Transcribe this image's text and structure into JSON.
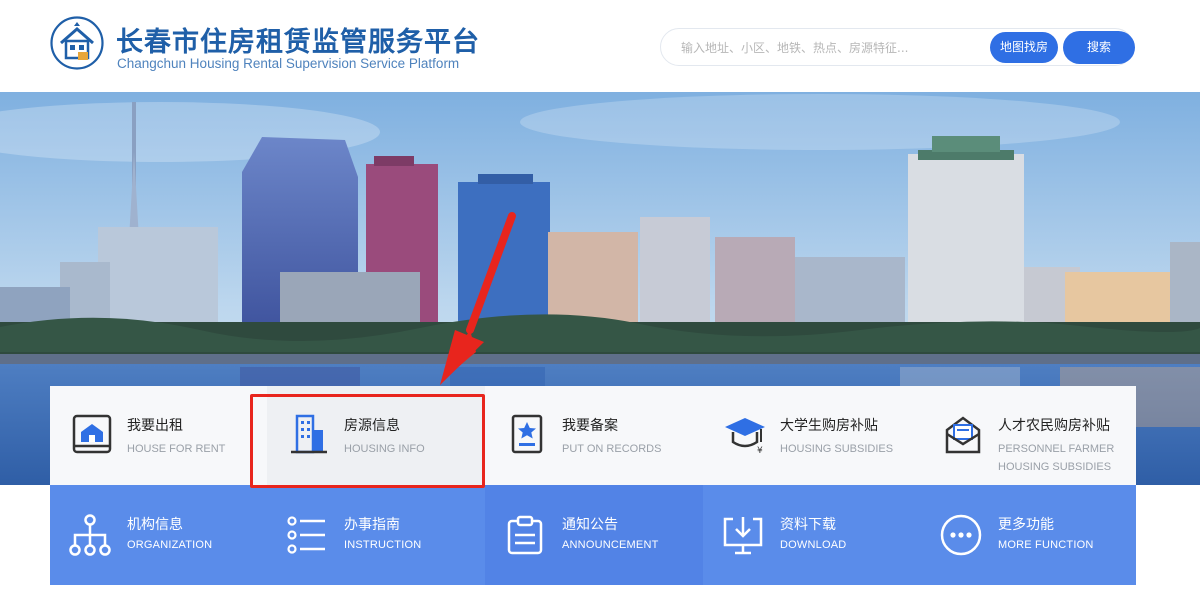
{
  "header": {
    "title": "长春市住房租赁监管服务平台",
    "subtitle": "Changchun Housing Rental Supervision Service Platform",
    "search_placeholder": "输入地址、小区、地铁、热点、房源特征...",
    "map_button": "地图找房",
    "search_button": "搜索"
  },
  "services_top": [
    {
      "cn": "我要出租",
      "en": "HOUSE FOR RENT",
      "icon": "house-rent-icon"
    },
    {
      "cn": "房源信息",
      "en": "HOUSING INFO",
      "icon": "building-icon"
    },
    {
      "cn": "我要备案",
      "en": "PUT ON RECORDS",
      "icon": "record-star-icon"
    },
    {
      "cn": "大学生购房补贴",
      "en": "HOUSING SUBSIDIES",
      "icon": "graduation-cap-icon"
    },
    {
      "cn": "人才农民购房补贴",
      "en": "PERSONNEL FARMER",
      "en2": "HOUSING SUBSIDIES",
      "icon": "mail-icon"
    }
  ],
  "services_bottom": [
    {
      "cn": "机构信息",
      "en": "ORGANIZATION",
      "icon": "org-chart-icon"
    },
    {
      "cn": "办事指南",
      "en": "INSTRUCTION",
      "icon": "list-icon"
    },
    {
      "cn": "通知公告",
      "en": "ANNOUNCEMENT",
      "icon": "clipboard-icon"
    },
    {
      "cn": "资料下载",
      "en": "DOWNLOAD",
      "icon": "download-icon"
    },
    {
      "cn": "更多功能",
      "en": "MORE FUNCTION",
      "icon": "more-icon"
    }
  ],
  "colors": {
    "brand": "#1f5fa8",
    "button": "#2f6fe4",
    "panel_blue": "#5a8cea",
    "highlight": "#e8251d"
  }
}
